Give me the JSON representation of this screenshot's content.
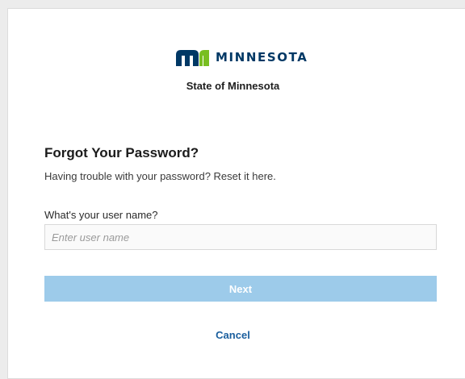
{
  "brand": {
    "logo_icon": "mn-logo-icon",
    "wordmark": "MINNESOTA",
    "org_name": "State of Minnesota",
    "colors": {
      "navy": "#003865",
      "green": "#78be21"
    }
  },
  "form": {
    "title": "Forgot Your Password?",
    "description": "Having trouble with your password? Reset it here.",
    "username_label": "What's your user name?",
    "username_placeholder": "Enter user name",
    "username_value": "",
    "next_label": "Next",
    "next_color": "#9dcbea",
    "cancel_label": "Cancel"
  }
}
